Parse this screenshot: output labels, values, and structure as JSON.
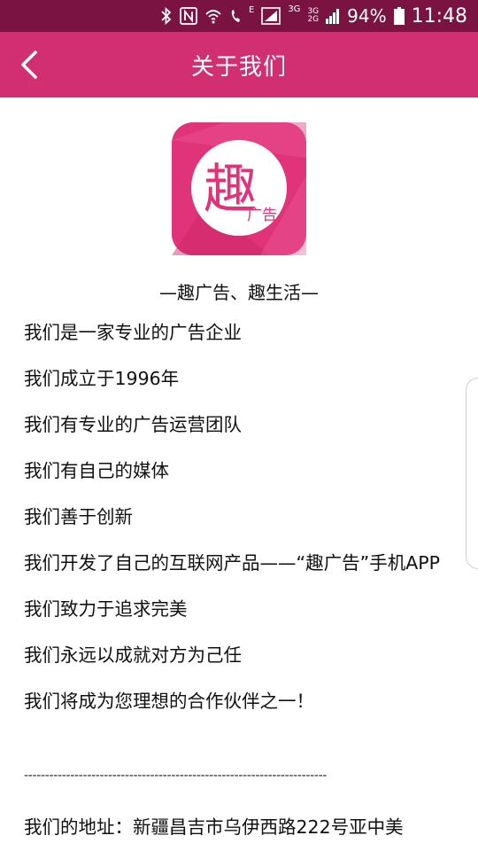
{
  "status_bar": {
    "network_e": "E",
    "net_3g": "3G",
    "net_3g_2g_top": "3G",
    "net_3g_2g_bottom": "2G",
    "battery_percent": "94%",
    "time": "11:48",
    "icons": [
      "bluetooth-icon",
      "nfc-icon",
      "wifi-call-icon",
      "call-icon",
      "signal-icon",
      "battery-icon"
    ]
  },
  "header": {
    "title": "关于我们",
    "back_icon": "chevron-left-icon"
  },
  "logo": {
    "main_char": "趣",
    "sub_text": "广告"
  },
  "slogan": "—趣广告、趣生活—",
  "lines": [
    "我们是一家专业的广告企业",
    "我们成立于1996年",
    "我们有专业的广告运营团队",
    "我们有自己的媒体",
    "我们善于创新",
    "我们开发了自己的互联网产品——“趣广告”手机APP",
    "我们致力于追求完美",
    "我们永远以成就对方为己任",
    "我们将成为您理想的合作伙伴之一！"
  ],
  "divider": "------------------------------------------------------------------------",
  "address": "我们的地址：新疆昌吉市乌伊西路222号亚中美",
  "colors": {
    "status_bar_bg": "#7a1242",
    "header_bg": "#d12f72",
    "logo_pink": "#e0337a"
  }
}
